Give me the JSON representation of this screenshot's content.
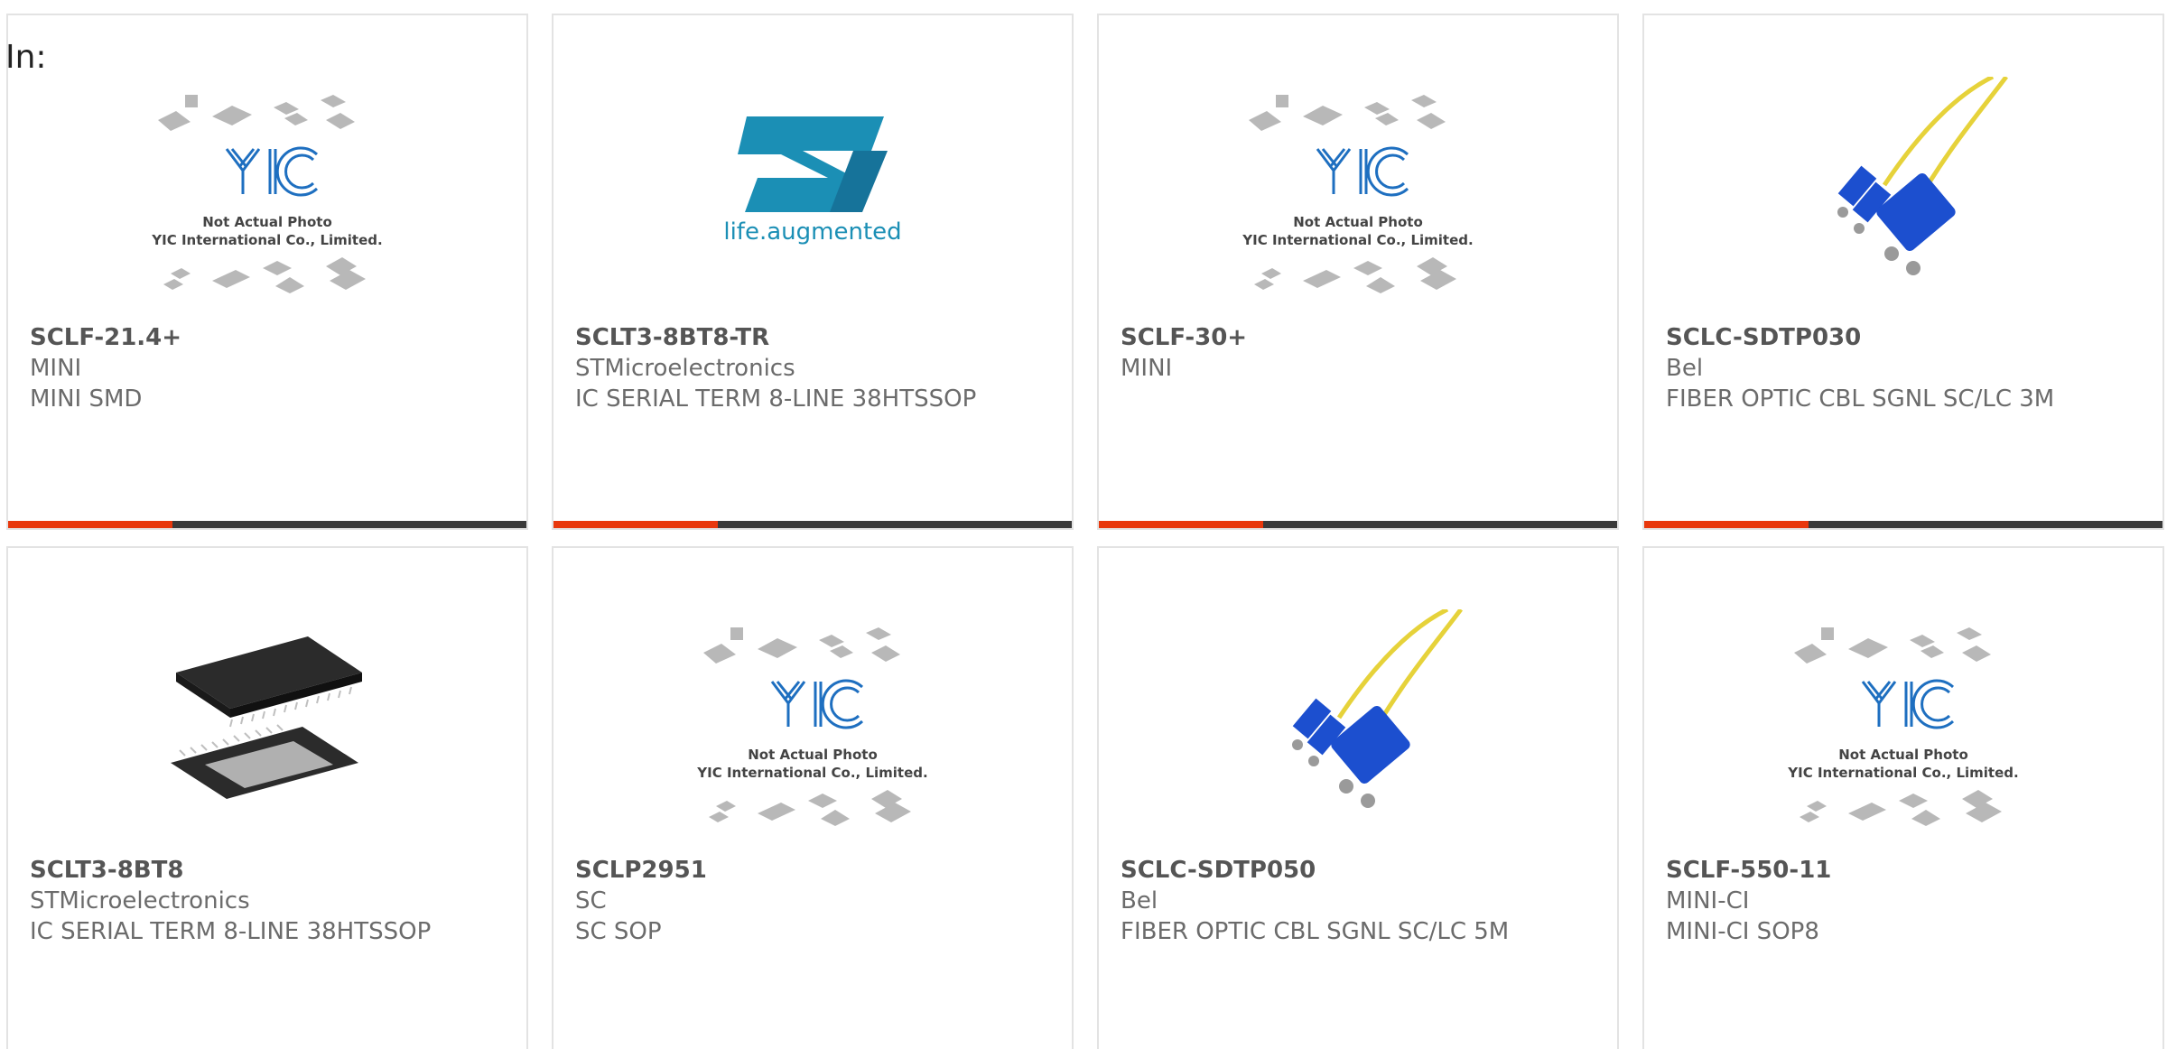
{
  "header": {
    "in_label": "In:"
  },
  "placeholder_text": {
    "line1": "Not Actual Photo",
    "line2": "YIC International Co., Limited."
  },
  "st_logo_text": "life.augmented",
  "colors": {
    "accent": "#e8380d",
    "bar": "#3a3a3a",
    "st_blue": "#1b8fb5",
    "fiber_blue": "#1c4fcf",
    "fiber_yellow": "#e6d23a"
  },
  "products": [
    {
      "part": "SCLF-21.4+",
      "maker": "MINI",
      "desc": "MINI SMD",
      "image": "yic-placeholder"
    },
    {
      "part": "SCLT3-8BT8-TR",
      "maker": "STMicroelectronics",
      "desc": "IC SERIAL TERM 8-LINE 38HTSSOP",
      "image": "st-logo"
    },
    {
      "part": "SCLF-30+",
      "maker": "MINI",
      "desc": "",
      "image": "yic-placeholder"
    },
    {
      "part": "SCLC-SDTP030",
      "maker": "Bel",
      "desc": "FIBER OPTIC CBL SGNL SC/LC 3M",
      "image": "fiber-cable"
    },
    {
      "part": "SCLT3-8BT8",
      "maker": "STMicroelectronics",
      "desc": "IC SERIAL TERM 8-LINE 38HTSSOP",
      "image": "ic-chip"
    },
    {
      "part": "SCLP2951",
      "maker": "SC",
      "desc": "SC SOP",
      "image": "yic-placeholder"
    },
    {
      "part": "SCLC-SDTP050",
      "maker": "Bel",
      "desc": "FIBER OPTIC CBL SGNL SC/LC 5M",
      "image": "fiber-cable"
    },
    {
      "part": "SCLF-550-11",
      "maker": "MINI-CI",
      "desc": "MINI-CI SOP8",
      "image": "yic-placeholder"
    }
  ]
}
